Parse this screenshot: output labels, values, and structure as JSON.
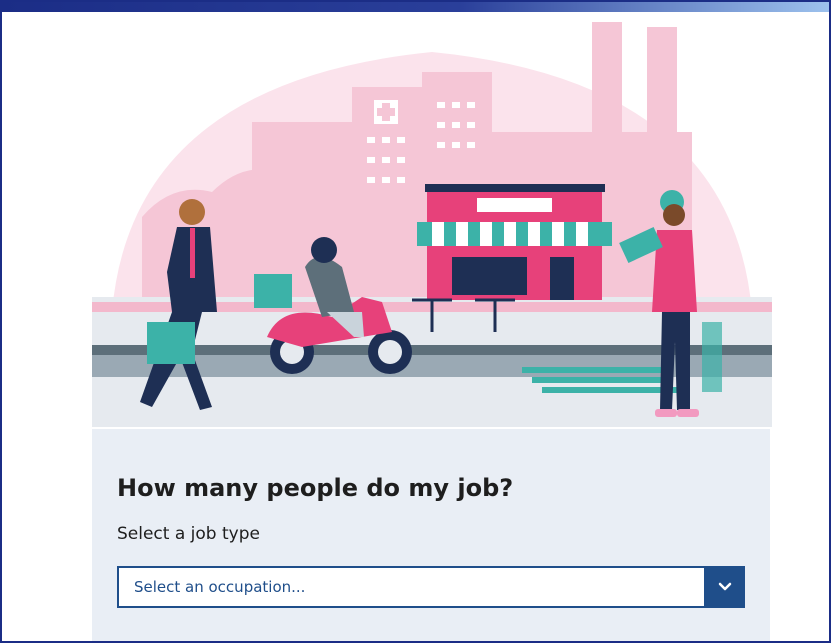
{
  "colors": {
    "frame_border": "#1b2d86",
    "panel_bg": "#e9eef5",
    "accent": "#1f4e8a",
    "illustration_pink": "#e7417a",
    "illustration_teal": "#3cb2a8"
  },
  "hero": {
    "image": "city-street-illustration"
  },
  "panel": {
    "heading": "How many people do my job?",
    "select_label": "Select a job type",
    "select_value": "Select an occupation...",
    "dropdown_icon": "chevron-down-icon"
  }
}
